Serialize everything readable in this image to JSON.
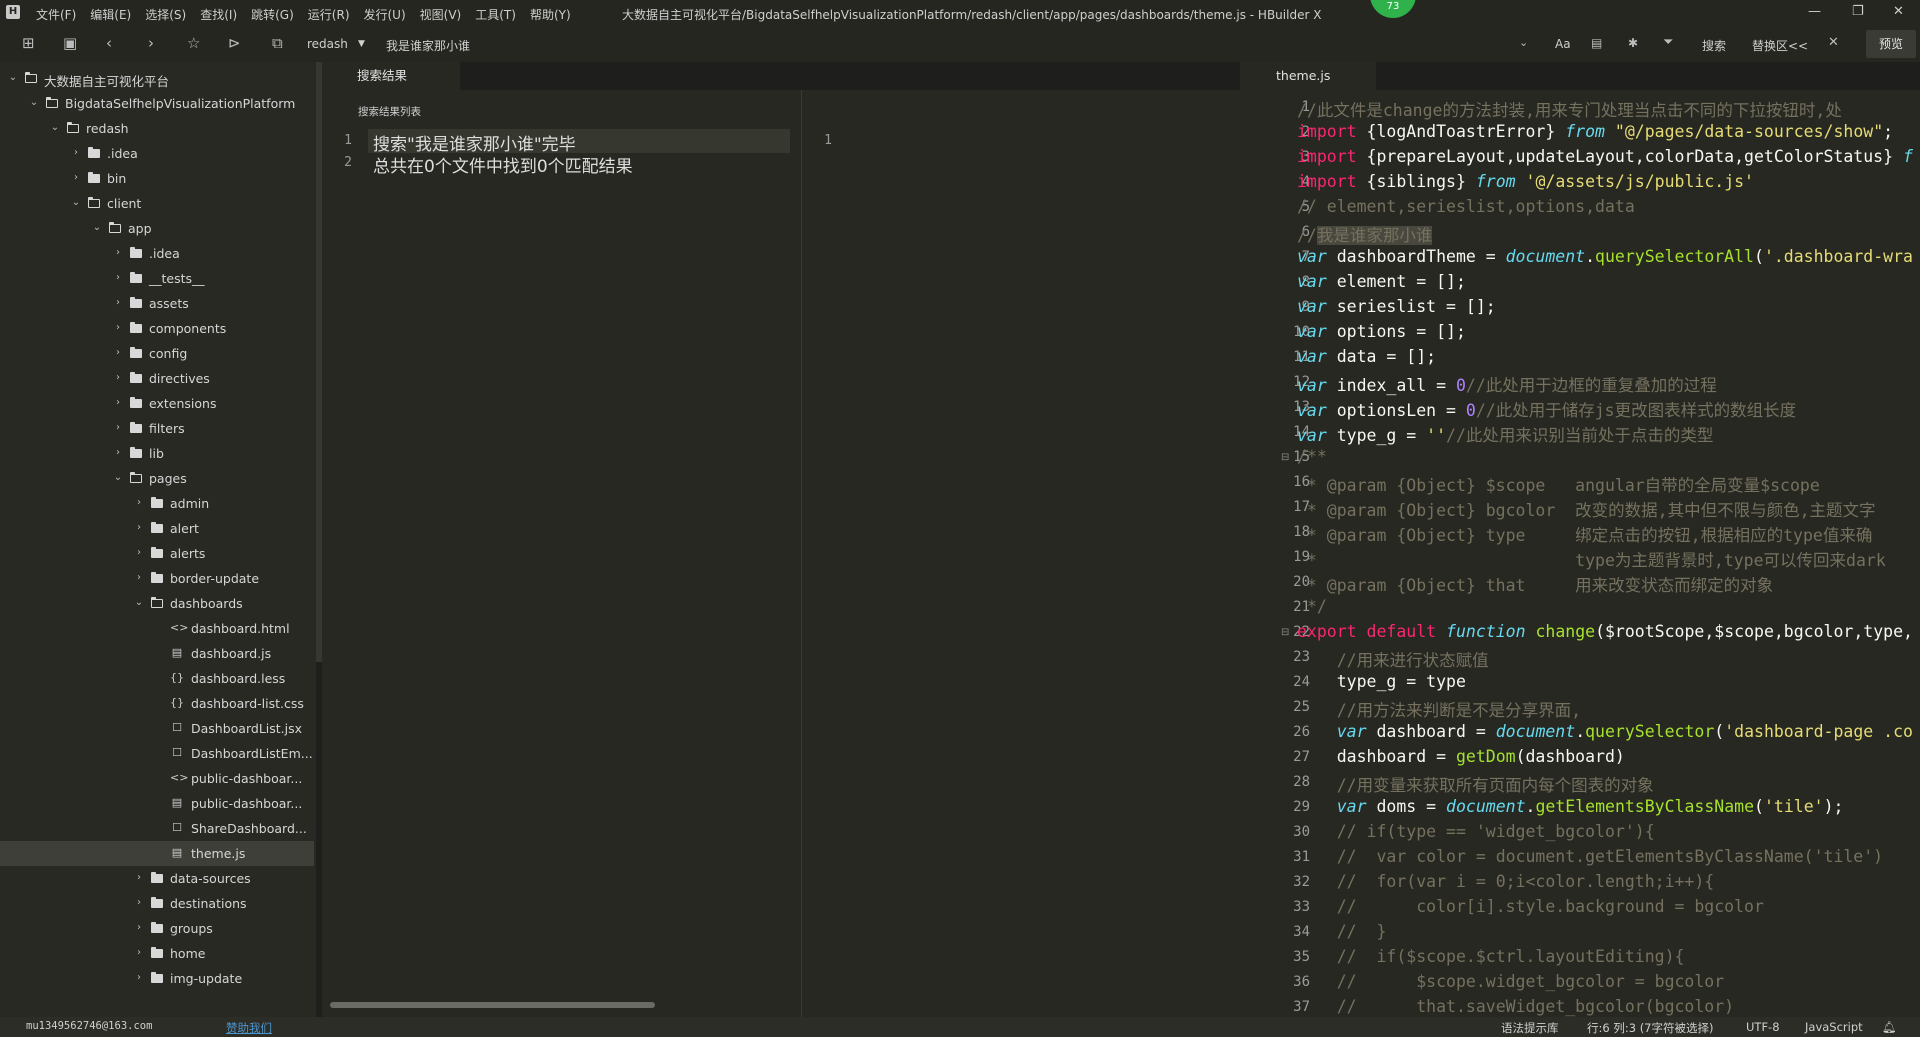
{
  "menubar": {
    "items": [
      "文件(F)",
      "编辑(E)",
      "选择(S)",
      "查找(I)",
      "跳转(G)",
      "运行(R)",
      "发行(U)",
      "视图(V)",
      "工具(T)",
      "帮助(Y)"
    ],
    "window_title": "大数据自主可视化平台/BigdataSelfhelpVisualizationPlatform/redash/client/app/pages/dashboards/theme.js - HBuilder X",
    "badge": "73"
  },
  "toolbar": {
    "project": "redash",
    "search_term": "我是谁家那小谁",
    "search_label": "搜索",
    "replace_label": "替换区<<",
    "preview_label": "预览"
  },
  "sidebar": {
    "items": [
      {
        "label": "大数据自主可视化平台",
        "level": 0,
        "kind": "root",
        "expanded": true
      },
      {
        "label": "BigdataSelfhelpVisualizationPlatform",
        "level": 1,
        "kind": "folder",
        "expanded": true
      },
      {
        "label": "redash",
        "level": 2,
        "kind": "folder",
        "expanded": true
      },
      {
        "label": ".idea",
        "level": 3,
        "kind": "folder",
        "expanded": false
      },
      {
        "label": "bin",
        "level": 3,
        "kind": "folder",
        "expanded": false
      },
      {
        "label": "client",
        "level": 3,
        "kind": "folder",
        "expanded": true
      },
      {
        "label": "app",
        "level": 4,
        "kind": "folder",
        "expanded": true
      },
      {
        "label": ".idea",
        "level": 5,
        "kind": "folder",
        "expanded": false
      },
      {
        "label": "__tests__",
        "level": 5,
        "kind": "folder",
        "expanded": false
      },
      {
        "label": "assets",
        "level": 5,
        "kind": "folder",
        "expanded": false
      },
      {
        "label": "components",
        "level": 5,
        "kind": "folder",
        "expanded": false
      },
      {
        "label": "config",
        "level": 5,
        "kind": "folder",
        "expanded": false
      },
      {
        "label": "directives",
        "level": 5,
        "kind": "folder",
        "expanded": false
      },
      {
        "label": "extensions",
        "level": 5,
        "kind": "folder",
        "expanded": false
      },
      {
        "label": "filters",
        "level": 5,
        "kind": "folder",
        "expanded": false
      },
      {
        "label": "lib",
        "level": 5,
        "kind": "folder",
        "expanded": false
      },
      {
        "label": "pages",
        "level": 5,
        "kind": "folder",
        "expanded": true
      },
      {
        "label": "admin",
        "level": 6,
        "kind": "folder",
        "expanded": false
      },
      {
        "label": "alert",
        "level": 6,
        "kind": "folder",
        "expanded": false
      },
      {
        "label": "alerts",
        "level": 6,
        "kind": "folder",
        "expanded": false
      },
      {
        "label": "border-update",
        "level": 6,
        "kind": "folder",
        "expanded": false
      },
      {
        "label": "dashboards",
        "level": 6,
        "kind": "folder",
        "expanded": true
      },
      {
        "label": "dashboard.html",
        "level": 7,
        "kind": "html"
      },
      {
        "label": "dashboard.js",
        "level": 7,
        "kind": "js"
      },
      {
        "label": "dashboard.less",
        "level": 7,
        "kind": "css"
      },
      {
        "label": "dashboard-list.css",
        "level": 7,
        "kind": "css"
      },
      {
        "label": "DashboardList.jsx",
        "level": 7,
        "kind": "file"
      },
      {
        "label": "DashboardListEm...",
        "level": 7,
        "kind": "file"
      },
      {
        "label": "public-dashboar...",
        "level": 7,
        "kind": "html"
      },
      {
        "label": "public-dashboar...",
        "level": 7,
        "kind": "js"
      },
      {
        "label": "ShareDashboard...",
        "level": 7,
        "kind": "file"
      },
      {
        "label": "theme.js",
        "level": 7,
        "kind": "js",
        "selected": true
      },
      {
        "label": "data-sources",
        "level": 6,
        "kind": "folder",
        "expanded": false
      },
      {
        "label": "destinations",
        "level": 6,
        "kind": "folder",
        "expanded": false
      },
      {
        "label": "groups",
        "level": 6,
        "kind": "folder",
        "expanded": false
      },
      {
        "label": "home",
        "level": 6,
        "kind": "folder",
        "expanded": false
      },
      {
        "label": "img-update",
        "level": 6,
        "kind": "folder",
        "expanded": false
      }
    ]
  },
  "search_panel": {
    "tab_label": "搜索结果",
    "list_label": "搜索结果列表",
    "lines": [
      "搜索\"我是谁家那小谁\"完毕",
      "总共在0个文件中找到0个匹配结果"
    ],
    "line_numbers": [
      "1",
      "2"
    ],
    "right_line_number": "1"
  },
  "editor": {
    "tab_label": "theme.js",
    "line_numbers": [
      "1",
      "2",
      "3",
      "4",
      "5",
      "6",
      "7",
      "8",
      "9",
      "10",
      "11",
      "12",
      "13",
      "14",
      "15",
      "16",
      "17",
      "18",
      "19",
      "20",
      "21",
      "22",
      "23",
      "24",
      "25",
      "26",
      "27",
      "28",
      "29",
      "30",
      "31",
      "32",
      "33",
      "34",
      "35",
      "36",
      "37"
    ]
  },
  "status": {
    "user": "mu1349562746@163.com",
    "sponsor": "赞助我们",
    "syntax_hint": "语法提示库",
    "cursor": "行:6  列:3 (7字符被选择)",
    "encoding": "UTF-8",
    "language": "JavaScript"
  },
  "colors": {
    "background": "#272822",
    "keyword": "#66d9ef",
    "string": "#e6db74",
    "comment": "#75715e",
    "function": "#a6e22e",
    "accent_badge": "#2fb24b"
  }
}
